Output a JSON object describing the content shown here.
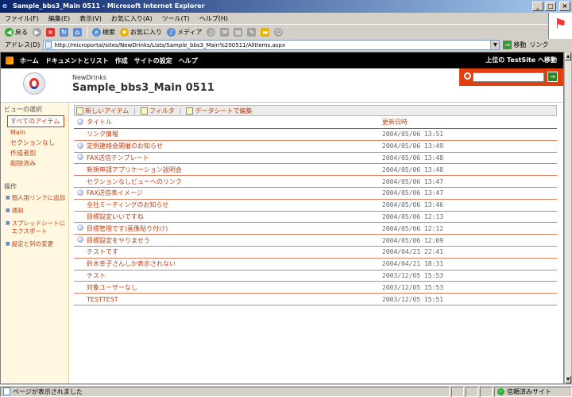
{
  "window": {
    "title": "Sample_bbs3_Main 0511 - Microsoft Internet Explorer",
    "controls": [
      "_",
      "□",
      "×"
    ]
  },
  "menubar": [
    "ファイル(F)",
    "編集(E)",
    "表示(V)",
    "お気に入り(A)",
    "ツール(T)",
    "ヘルプ(H)"
  ],
  "toolbar": {
    "back": "戻る",
    "search": "検索",
    "favorites": "お気に入り",
    "media": "メディア"
  },
  "address": {
    "label": "アドレス(D)",
    "url": "http://microportal/sites/NewDrinks/Lists/Sample_bbs3_Main%200511/AllItems.aspx",
    "go": "移動",
    "links": "リンク"
  },
  "spnav": {
    "items": [
      "ホーム",
      "ドキュメントとリスト",
      "作成",
      "サイトの設定",
      "ヘルプ"
    ],
    "parent_link": "上位の TestSite へ移動"
  },
  "header": {
    "site_name": "NewDrinks",
    "list_title": "Sample_bbs3_Main 0511"
  },
  "leftnav": {
    "views_heading": "ビューの選択",
    "views": [
      "すべてのアイテム",
      "Main",
      "セクションなし",
      "作成者別",
      "削除済み"
    ],
    "actions_heading": "操作",
    "actions": [
      "個人用リンクに追加",
      "通知",
      "スプレッドシートにエクスポート",
      "設定と列の変更"
    ]
  },
  "list": {
    "toolbar": {
      "new_item": "新しいアイテム",
      "filter": "フィルタ",
      "datasheet": "データシートで編集"
    },
    "columns": {
      "title": "タイトル",
      "modified": "更新日時"
    },
    "rows": [
      {
        "title": "リンク情報",
        "modified": "2004/05/06 13:51",
        "attach": false
      },
      {
        "title": "定例連絡会開催のお知らせ",
        "modified": "2004/05/06 13:49",
        "attach": true
      },
      {
        "title": "FAX送信テンプレート",
        "modified": "2004/05/06 13:48",
        "attach": true
      },
      {
        "title": "新規申請アプリケーション説明会",
        "modified": "2004/05/06 13:48",
        "attach": false
      },
      {
        "title": "セクションなしビューへのリンク",
        "modified": "2004/05/06 13:47",
        "attach": false
      },
      {
        "title": "FAX送信表イメージ",
        "modified": "2004/05/06 13:47",
        "attach": true
      },
      {
        "title": "全社ミーティングのお知らせ",
        "modified": "2004/05/06 13:46",
        "attach": false
      },
      {
        "title": "目標設定いいですね",
        "modified": "2004/05/06 12:13",
        "attach": false
      },
      {
        "title": "目標管理です(画像貼り付け)",
        "modified": "2004/05/06 12:12",
        "attach": true
      },
      {
        "title": "目標設定をやりませう",
        "modified": "2004/05/06 12:09",
        "attach": true
      },
      {
        "title": "テストです",
        "modified": "2004/04/21 22:41",
        "attach": false
      },
      {
        "title": "鈴木幸子さんしか表示されない",
        "modified": "2004/04/21 18:31",
        "attach": false
      },
      {
        "title": "テスト",
        "modified": "2003/12/05 15:53",
        "attach": false
      },
      {
        "title": "対象ユーザーなし",
        "modified": "2003/12/05 15:53",
        "attach": false
      },
      {
        "title": "TESTTEST",
        "modified": "2003/12/05 15:51",
        "attach": false
      }
    ]
  },
  "status": {
    "text": "ページが表示されました",
    "zone": "信頼済みサイト"
  }
}
